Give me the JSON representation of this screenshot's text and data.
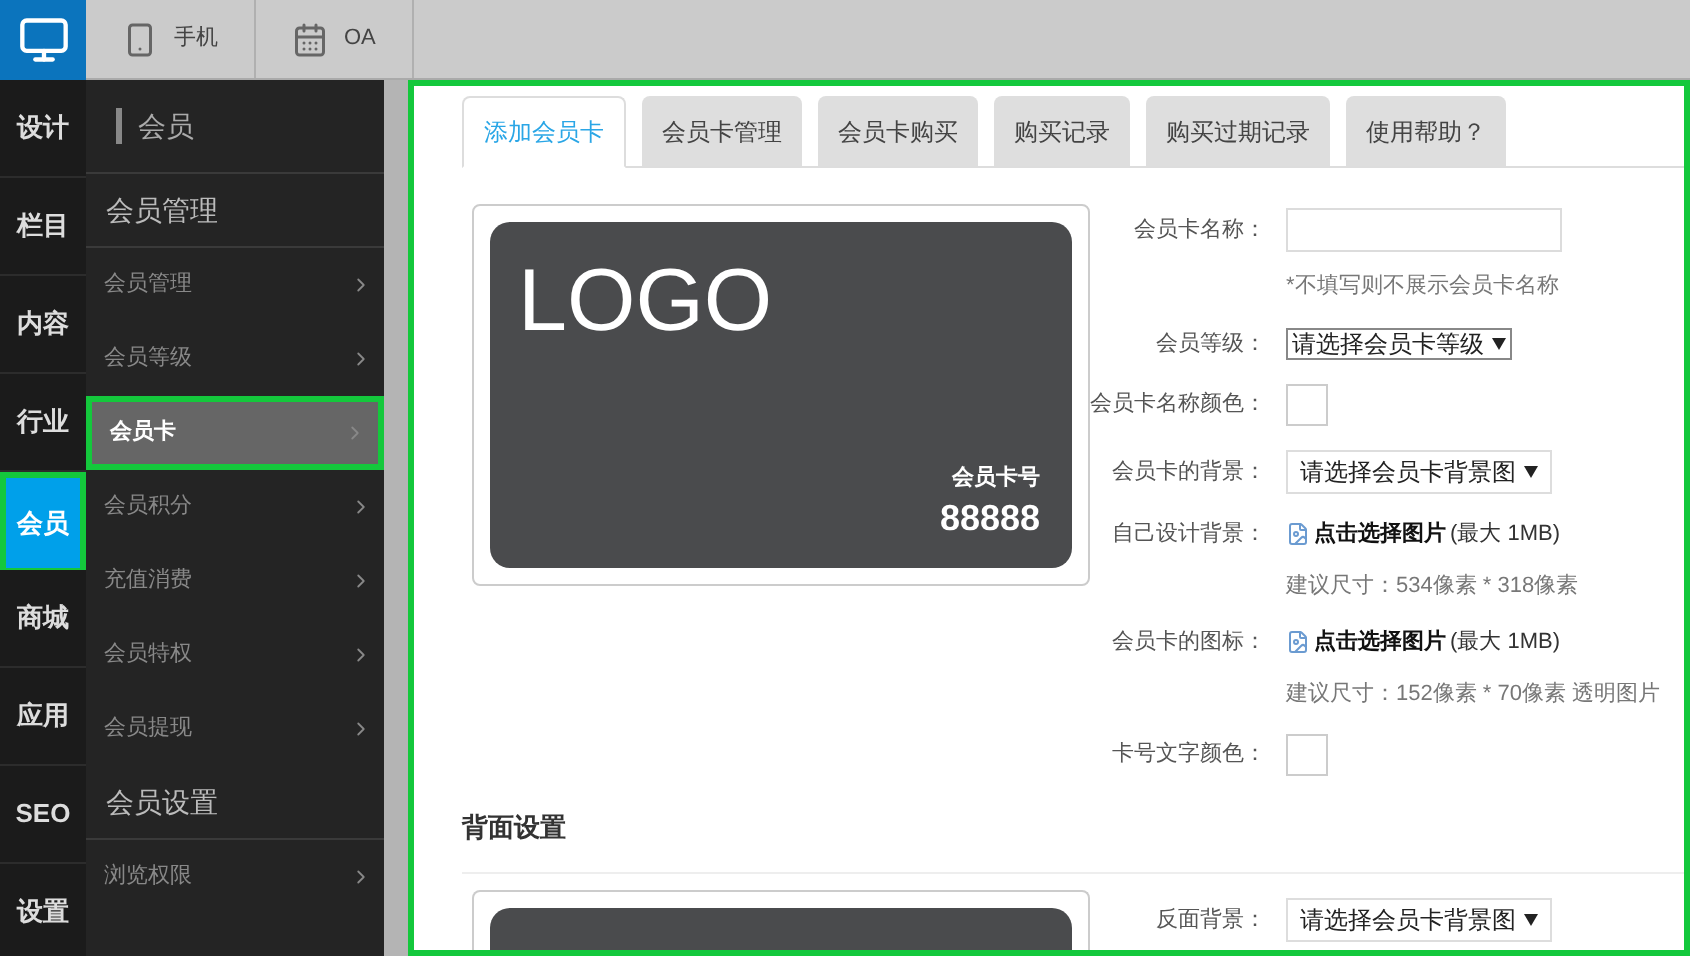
{
  "top_bar": {
    "tabs": [
      {
        "label": "手机",
        "selected": false
      },
      {
        "label": "OA",
        "selected": false
      }
    ]
  },
  "rail": [
    {
      "label": "设计",
      "selected": false
    },
    {
      "label": "栏目",
      "selected": false
    },
    {
      "label": "内容",
      "selected": false
    },
    {
      "label": "行业",
      "selected": false
    },
    {
      "label": "会员",
      "selected": true
    },
    {
      "label": "商城",
      "selected": false
    },
    {
      "label": "应用",
      "selected": false
    },
    {
      "label": "SEO",
      "selected": false
    },
    {
      "label": "设置",
      "selected": false
    }
  ],
  "sidebar": {
    "title": "会员",
    "sections": [
      {
        "title": "会员管理",
        "items": [
          {
            "label": "会员管理",
            "selected": false
          },
          {
            "label": "会员等级",
            "selected": false
          },
          {
            "label": "会员卡",
            "selected": true
          },
          {
            "label": "会员积分",
            "selected": false
          },
          {
            "label": "充值消费",
            "selected": false
          },
          {
            "label": "会员特权",
            "selected": false
          },
          {
            "label": "会员提现",
            "selected": false
          }
        ]
      },
      {
        "title": "会员设置",
        "items": [
          {
            "label": "浏览权限",
            "selected": false
          }
        ]
      }
    ]
  },
  "tabs": [
    {
      "label": "添加会员卡",
      "selected": true
    },
    {
      "label": "会员卡管理",
      "selected": false
    },
    {
      "label": "会员卡购买",
      "selected": false
    },
    {
      "label": "购买记录",
      "selected": false
    },
    {
      "label": "购买过期记录",
      "selected": false
    },
    {
      "label": "使用帮助？",
      "selected": false
    }
  ],
  "card_preview": {
    "logo": "LOGO",
    "number_label": "会员卡号",
    "number": "88888"
  },
  "form": [
    {
      "kind": "text",
      "label": "会员卡名称：",
      "hint": "*不填写则不展示会员卡名称"
    },
    {
      "kind": "select",
      "label": "会员等级：",
      "value": "请选择会员卡等级",
      "compact": true
    },
    {
      "kind": "color",
      "label": "会员卡名称颜色："
    },
    {
      "kind": "select",
      "label": "会员卡的背景：",
      "value": "请选择会员卡背景图",
      "compact": false
    },
    {
      "kind": "file",
      "label": "自己设计背景：",
      "value": "点击选择图片",
      "limit": "(最大 1MB)",
      "hint": "建议尺寸：534像素 * 318像素"
    },
    {
      "kind": "file",
      "label": "会员卡的图标：",
      "value": "点击选择图片",
      "limit": "(最大 1MB)",
      "hint": "建议尺寸：152像素 * 70像素 透明图片"
    },
    {
      "kind": "color",
      "label": "卡号文字颜色："
    }
  ],
  "back_section": {
    "title": "背面设置",
    "form": [
      {
        "kind": "select",
        "label": "反面背景：",
        "value": "请选择会员卡背景图",
        "compact": false
      }
    ]
  }
}
